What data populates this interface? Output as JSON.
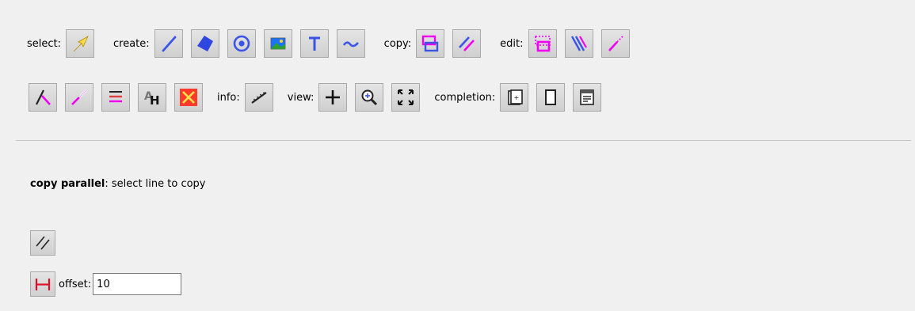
{
  "toolbar": {
    "row1": [
      {
        "type": "label",
        "text": "select:"
      },
      {
        "type": "button",
        "icon": "select-arrow-icon"
      },
      {
        "type": "label",
        "text": "create:"
      },
      {
        "type": "button",
        "icon": "line-icon"
      },
      {
        "type": "button",
        "icon": "polygon-icon"
      },
      {
        "type": "button",
        "icon": "circle-icon"
      },
      {
        "type": "button",
        "icon": "image-icon"
      },
      {
        "type": "button",
        "icon": "text-icon"
      },
      {
        "type": "button",
        "icon": "spline-icon"
      },
      {
        "type": "label",
        "text": "copy:"
      },
      {
        "type": "button",
        "icon": "copy-objects-icon"
      },
      {
        "type": "button",
        "icon": "copy-parallel-icon"
      },
      {
        "type": "label",
        "text": "edit:"
      },
      {
        "type": "button",
        "icon": "edit-box-icon"
      },
      {
        "type": "button",
        "icon": "hatch-icon"
      },
      {
        "type": "button",
        "icon": "extend-line-icon"
      }
    ],
    "row2": [
      {
        "type": "button",
        "icon": "angle-icon"
      },
      {
        "type": "button",
        "icon": "trim-line-icon"
      },
      {
        "type": "button",
        "icon": "line-attributes-icon"
      },
      {
        "type": "button",
        "icon": "text-attributes-icon"
      },
      {
        "type": "button",
        "icon": "delete-icon"
      },
      {
        "type": "label",
        "text": "info:"
      },
      {
        "type": "button",
        "icon": "measure-icon"
      },
      {
        "type": "label",
        "text": "view:"
      },
      {
        "type": "button",
        "icon": "pan-icon"
      },
      {
        "type": "button",
        "icon": "zoom-icon"
      },
      {
        "type": "button",
        "icon": "fit-view-icon"
      },
      {
        "type": "label",
        "text": "completion:"
      },
      {
        "type": "button",
        "icon": "new-sheet-icon"
      },
      {
        "type": "button",
        "icon": "page-icon"
      },
      {
        "type": "button",
        "icon": "properties-icon"
      }
    ]
  },
  "status": {
    "command": "copy parallel",
    "separator": ":",
    "prompt": " select line to copy"
  },
  "options": {
    "offset_label": "offset:",
    "offset_value": "10"
  },
  "colors": {
    "background": "#f0f0f0",
    "accent_blue": "#3b54e6",
    "accent_magenta": "#f000f0",
    "separator": "#c4c4c4"
  }
}
